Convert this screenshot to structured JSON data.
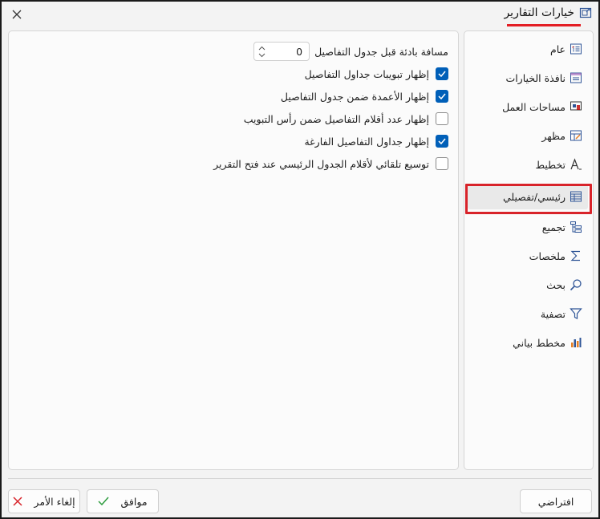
{
  "window": {
    "title": "خيارات التقارير",
    "title_icon": "report-options-icon",
    "close_icon": "close-icon",
    "accent_color": "#005fb8",
    "highlight_color": "#e31e24"
  },
  "nav": {
    "items": [
      {
        "label": "عام",
        "icon": "general-icon"
      },
      {
        "label": "نافذة الخيارات",
        "icon": "options-window-icon"
      },
      {
        "label": "مساحات العمل",
        "icon": "workspaces-icon"
      },
      {
        "label": "مظهر",
        "icon": "appearance-icon"
      },
      {
        "label": "تخطيط",
        "icon": "layout-icon"
      },
      {
        "label": "رئيسي/تفصيلي",
        "icon": "master-detail-icon",
        "selected": true
      },
      {
        "label": "تجميع",
        "icon": "grouping-icon"
      },
      {
        "label": "ملخصات",
        "icon": "summaries-icon"
      },
      {
        "label": "بحث",
        "icon": "search-icon"
      },
      {
        "label": "تصفية",
        "icon": "filter-icon"
      },
      {
        "label": "مخطط بياني",
        "icon": "chart-icon"
      }
    ]
  },
  "content": {
    "spacing": {
      "label": "مسافة بادئة قبل جدول التفاصيل",
      "value": "0"
    },
    "options": [
      {
        "label": "إظهار تبويبات جداول التفاصيل",
        "checked": true
      },
      {
        "label": "إظهار الأعمدة ضمن جدول التفاصيل",
        "checked": true
      },
      {
        "label": "إظهار عدد أقلام التفاصيل ضمن رأس التبويب",
        "checked": false
      },
      {
        "label": "إظهار جداول التفاصيل الفارغة",
        "checked": true
      },
      {
        "label": "توسيع تلقائي لأقلام الجدول الرئيسي عند فتح التقرير",
        "checked": false
      }
    ]
  },
  "buttons": {
    "default": "افتراضي",
    "ok": "موافق",
    "cancel": "إلغاء الأمر"
  }
}
